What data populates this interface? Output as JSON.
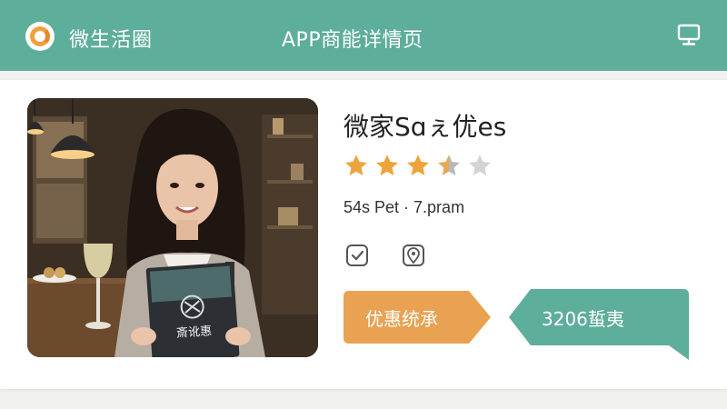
{
  "header": {
    "app_name": "微生活圈",
    "page_title": "APP商能详情页",
    "logo": "circle-logo-icon",
    "right_icon": "monitor-icon"
  },
  "shop": {
    "title": "微家Sɑぇ优es",
    "rating": 3.5,
    "rating_max": 5,
    "meta": "54s Pet · 7.pram",
    "photo_sign_text": "斎讹惠"
  },
  "actions": {
    "primary_label": "优惠统承",
    "secondary_label": "3206蜇夷",
    "icons": [
      "checkbox-icon",
      "location-pin-icon"
    ]
  },
  "colors": {
    "header": "#5dae9a",
    "accent_orange": "#e8a252",
    "accent_green": "#5dae9a",
    "star_filled": "#eea33a",
    "star_empty": "#c8c8c8"
  }
}
